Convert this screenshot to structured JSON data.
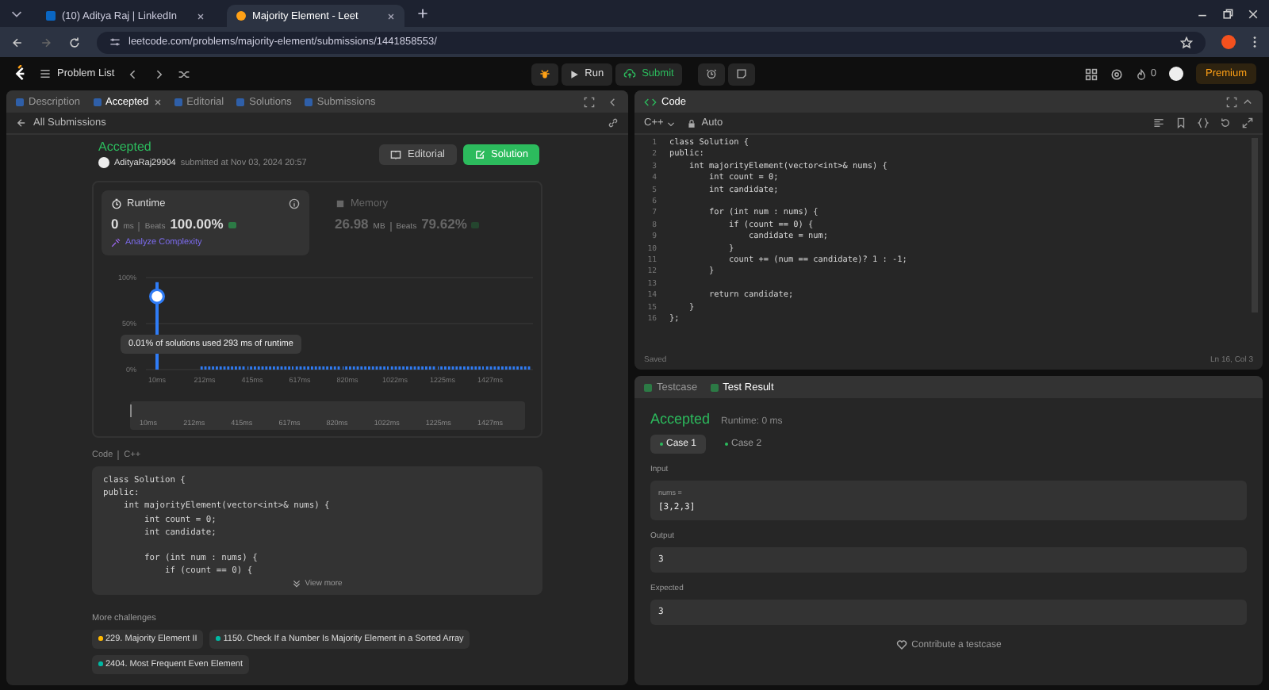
{
  "browser": {
    "tabs": [
      {
        "title": "(10) Aditya Raj | LinkedIn",
        "selected": false
      },
      {
        "title": "Majority Element - Leet",
        "selected": true
      }
    ],
    "url": "leetcode.com/problems/majority-element/submissions/1441858553/"
  },
  "nav": {
    "problem_list": "Problem List",
    "run": "Run",
    "submit": "Submit",
    "streak": "0",
    "premium": "Premium"
  },
  "left": {
    "tabs": [
      {
        "label": "Description",
        "selected": false,
        "closable": false
      },
      {
        "label": "Accepted",
        "selected": true,
        "closable": true
      },
      {
        "label": "Editorial",
        "selected": false,
        "closable": false
      },
      {
        "label": "Solutions",
        "selected": false,
        "closable": false
      },
      {
        "label": "Submissions",
        "selected": false,
        "closable": false
      }
    ],
    "back_link": "All Submissions",
    "status": "Accepted",
    "user": "AdityaRaj29904",
    "submitted": "submitted at Nov 03, 2024 20:57",
    "buttons": [
      {
        "label": "Editorial",
        "kind": "secondary"
      },
      {
        "label": "Solution",
        "kind": "primary"
      }
    ],
    "stats": [
      {
        "title": "Runtime",
        "value": "0",
        "unit": "ms",
        "beats_label": "Beats",
        "beats": "100.00%",
        "selected": true,
        "link": "Analyze Complexity"
      },
      {
        "title": "Memory",
        "value": "26.98",
        "unit": "MB",
        "beats_label": "Beats",
        "beats": "79.62%",
        "selected": false
      }
    ],
    "chart_data": {
      "type": "bar",
      "categories": [
        "10ms",
        "212ms",
        "415ms",
        "617ms",
        "820ms",
        "1022ms",
        "1225ms",
        "1427ms"
      ],
      "values": [
        95,
        0,
        0,
        0,
        0,
        0,
        0,
        0
      ],
      "ylim": [
        0,
        100
      ],
      "grid": true,
      "yticks": [
        {
          "value": 0,
          "label": "0%"
        },
        {
          "value": 50,
          "label": "50%"
        },
        {
          "value": 100,
          "label": "100%"
        }
      ]
    },
    "tooltip": "0.01% of solutions used 293 ms of runtime",
    "range": {
      "level": 0,
      "labels": [
        "10ms",
        "212ms",
        "415ms",
        "617ms",
        "820ms",
        "1022ms",
        "1225ms",
        "1427ms"
      ]
    },
    "code_label": "Code",
    "code_lang": "C++",
    "code": "class Solution {\npublic:\n    int majorityElement(vector<int>& nums) {\n        int count = 0;\n        int candidate;\n\n        for (int num : nums) {\n            if (count == 0) {",
    "view_more": "View more",
    "more_title": "More challenges",
    "challenges": [
      {
        "label": "229. Majority Element II",
        "color": "#ffb800"
      },
      {
        "label": "1150. Check If a Number Is Majority Element in a Sorted Array",
        "color": "#00b8a3"
      },
      {
        "label": "2404. Most Frequent Even Element",
        "color": "#00b8a3"
      }
    ]
  },
  "code_panel": {
    "title": "Code",
    "language": "C++",
    "mode": "Auto",
    "line_numbers": [
      "1",
      "2",
      "3",
      "4",
      "5",
      "6",
      "7",
      "8",
      "9",
      "10",
      "11",
      "12",
      "13",
      "14",
      "15",
      "16"
    ],
    "code": "class Solution {\npublic:\n    int majorityElement(vector<int>& nums) {\n        int count = 0;\n        int candidate;\n\n        for (int num : nums) {\n            if (count == 0) {\n                candidate = num;\n            }\n            count += (num == candidate)? 1 : -1;\n        }\n\n        return candidate;\n    }\n};",
    "status": "Saved",
    "cursor": "Ln 16, Col 3"
  },
  "test_panel": {
    "tabs": [
      {
        "label": "Testcase",
        "selected": false
      },
      {
        "label": "Test Result",
        "selected": true
      }
    ],
    "status": "Accepted",
    "runtime": "Runtime: 0 ms",
    "cases": [
      {
        "label": "Case 1",
        "selected": true
      },
      {
        "label": "Case 2",
        "selected": false
      }
    ],
    "input_label": "Input",
    "param": "nums =",
    "input": "[3,2,3]",
    "output_label": "Output",
    "output": "3",
    "expected_label": "Expected",
    "expected": "3",
    "contribute": "Contribute a testcase"
  }
}
